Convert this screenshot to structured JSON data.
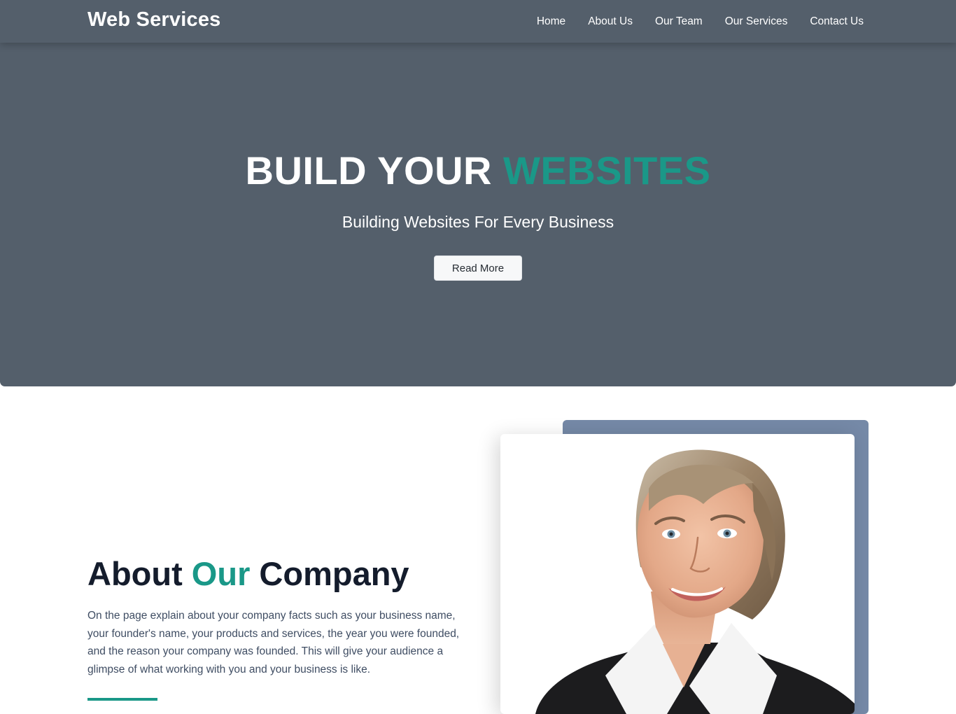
{
  "navbar": {
    "brand": "Web Services",
    "links": [
      {
        "label": "Home"
      },
      {
        "label": "About Us"
      },
      {
        "label": "Our Team"
      },
      {
        "label": "Our Services"
      },
      {
        "label": "Contact Us"
      }
    ]
  },
  "hero": {
    "title_part1": "BUILD YOUR",
    "title_accent": "WEBSITES",
    "subtitle": "Building Websites For Every Business",
    "button_label": "Read More"
  },
  "about": {
    "title_part1": "About",
    "title_accent": "Our",
    "title_part2": "Company",
    "paragraph": "On the page explain about your company facts such as your business name, your founder's name, your products and services, the year you were founded, and the reason your company was founded. This will give your audience a glimpse of what working with you and your business is like."
  },
  "colors": {
    "header_bg": "#545f6b",
    "accent": "#1a9888",
    "heading_dark": "#141c2c",
    "photo_back": "#7589a7"
  }
}
